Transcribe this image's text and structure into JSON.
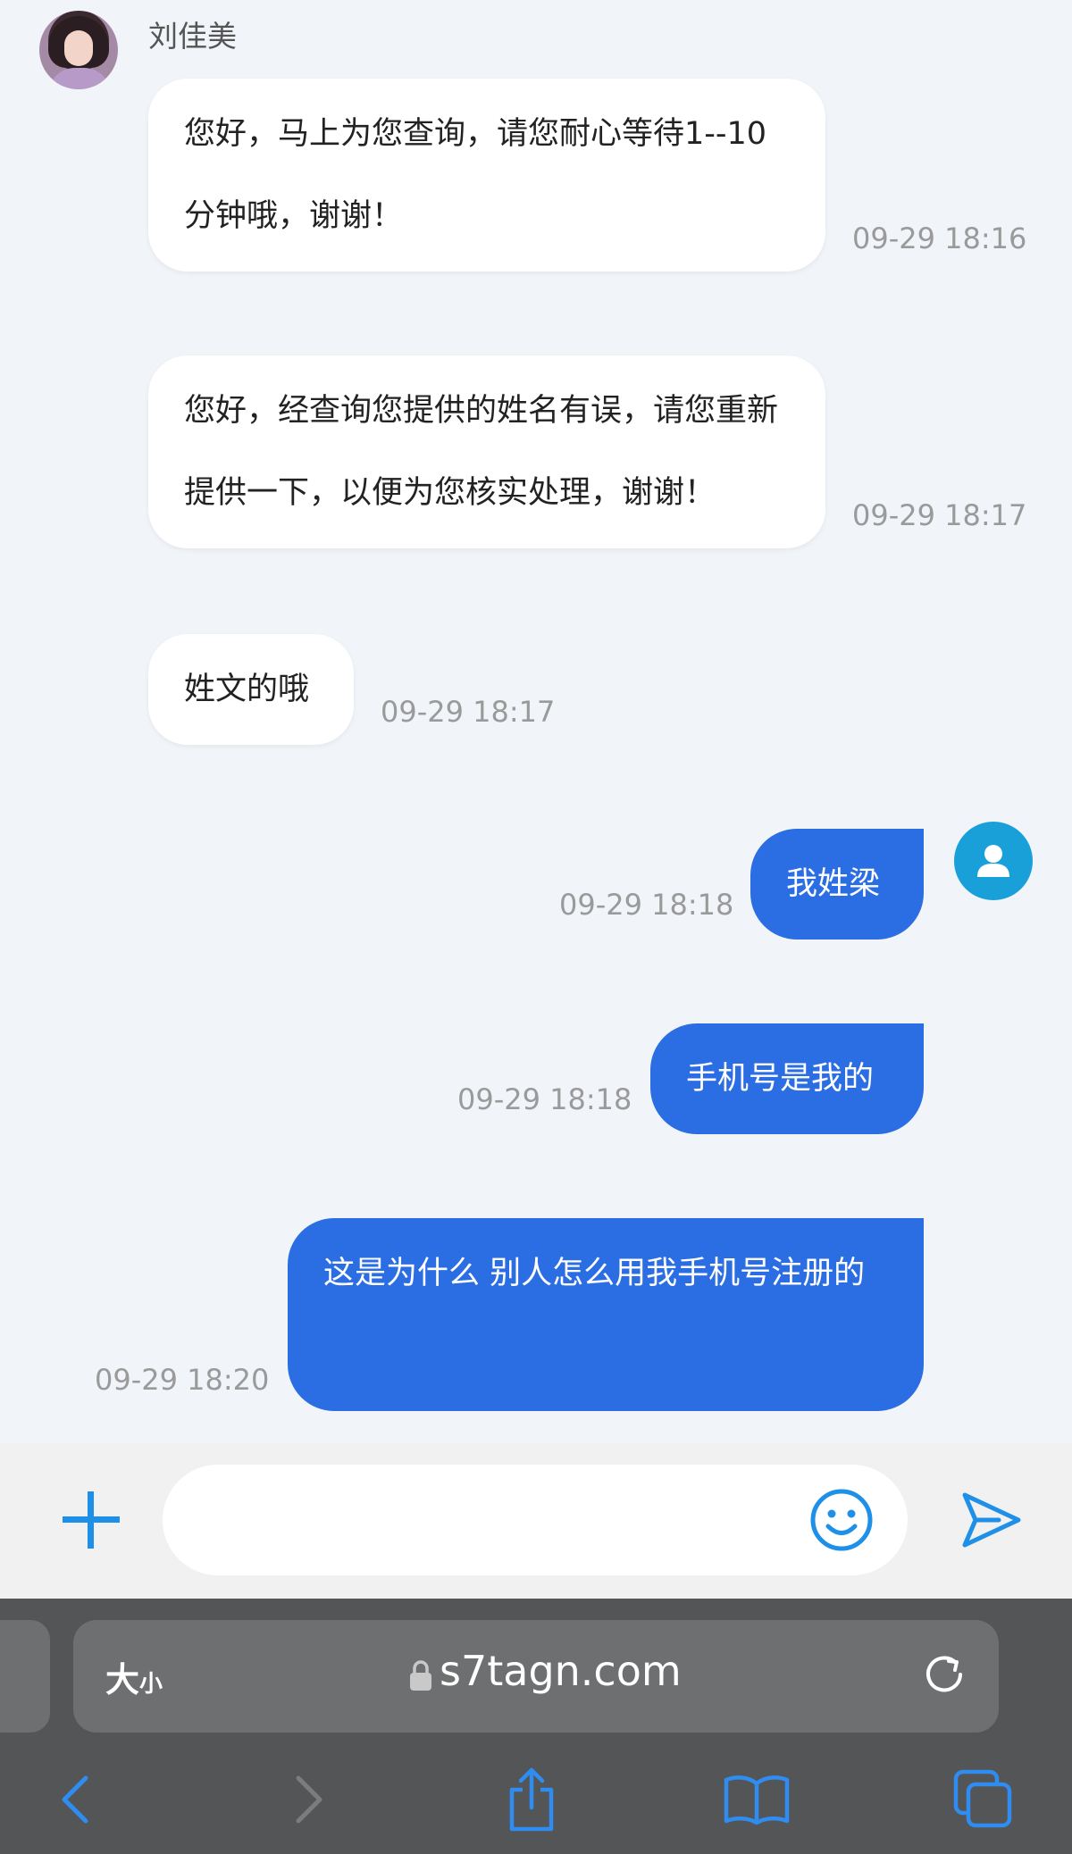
{
  "agent": {
    "name": "刘佳美"
  },
  "messages": [
    {
      "side": "in",
      "text": "您好，马上为您查询，请您耐心等待1--10分钟哦，谢谢！",
      "time": "09-29 18:16"
    },
    {
      "side": "in",
      "text": "您好，经查询您提供的姓名有误，请您重新提供一下，以便为您核实处理，谢谢！",
      "time": "09-29 18:17"
    },
    {
      "side": "in",
      "text": "姓文的哦",
      "time": "09-29 18:17"
    },
    {
      "side": "out",
      "text": "我姓梁",
      "time": "09-29 18:18"
    },
    {
      "side": "out",
      "text": "手机号是我的",
      "time": "09-29 18:18"
    },
    {
      "side": "out",
      "text": "这是为什么 别人怎么用我手机号注册的",
      "time": "09-29 18:20"
    }
  ],
  "composer": {
    "placeholder": "",
    "value": "",
    "add_icon": "plus-icon",
    "emoji_icon": "smiley-icon",
    "send_icon": "send-icon"
  },
  "browser": {
    "text_size_label_big": "大",
    "text_size_label_small": "小",
    "url": "s7tagn.com",
    "accent": "#2f8cf0"
  },
  "colors": {
    "outgoing_bubble": "#2b6ee3",
    "incoming_bubble": "#ffffff",
    "background": "#f1f5f9",
    "user_avatar": "#1aa0d8"
  }
}
